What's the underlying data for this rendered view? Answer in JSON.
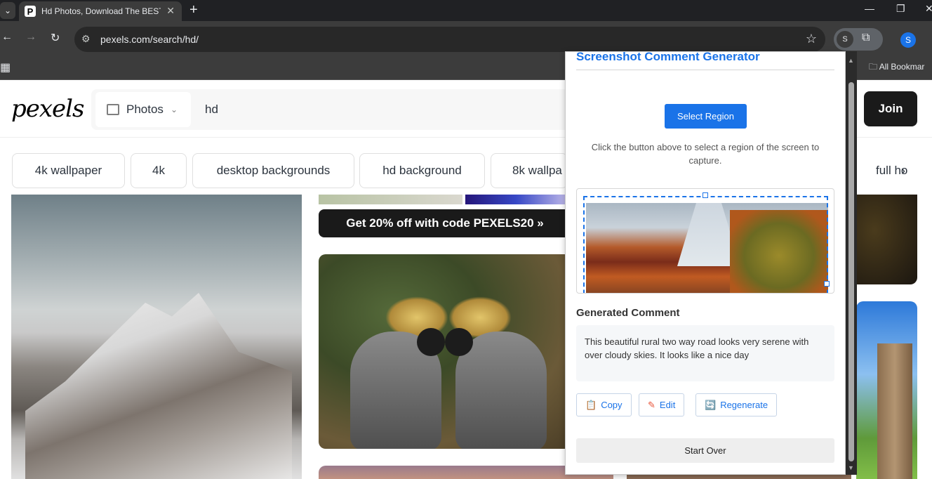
{
  "browser": {
    "tab_title": "Hd Photos, Download The BEST",
    "tab_favicon": "P",
    "tab_close": "✕",
    "new_tab": "+",
    "url": "pexels.com/search/hd/",
    "profile_initial": "S",
    "avatar_initial": "S",
    "bookmarks_label": "All Bookmar",
    "icons": [
      "back-icon",
      "forward-icon",
      "reload-icon",
      "site-info-icon",
      "star-icon",
      "puzzle-icon",
      "apps-icon",
      "folder-icon"
    ]
  },
  "site": {
    "logo": "pexels",
    "search_type": "Photos",
    "query": "hd",
    "join_label": "Join",
    "chips": [
      "4k wallpaper",
      "4k",
      "desktop backgrounds",
      "hd background",
      "8k wallpa",
      "full ho"
    ],
    "promo": "Get 20% off with code PEXELS20 »"
  },
  "popup": {
    "title": "Screenshot Comment Generator",
    "select_button": "Select Region",
    "instructions": "Click the button above to select a region of the screen to capture.",
    "generated_heading": "Generated Comment",
    "generated_text": "This beautiful rural two way road looks very serene with over cloudy skies. It looks like a nice day",
    "copy_label": "Copy",
    "edit_label": "Edit",
    "regenerate_label": "Regenerate",
    "start_over_label": "Start Over"
  },
  "colors": {
    "accent": "#1a73e8",
    "dark_button": "#1a1a1a",
    "chrome_bg": "#3c3c3c"
  }
}
